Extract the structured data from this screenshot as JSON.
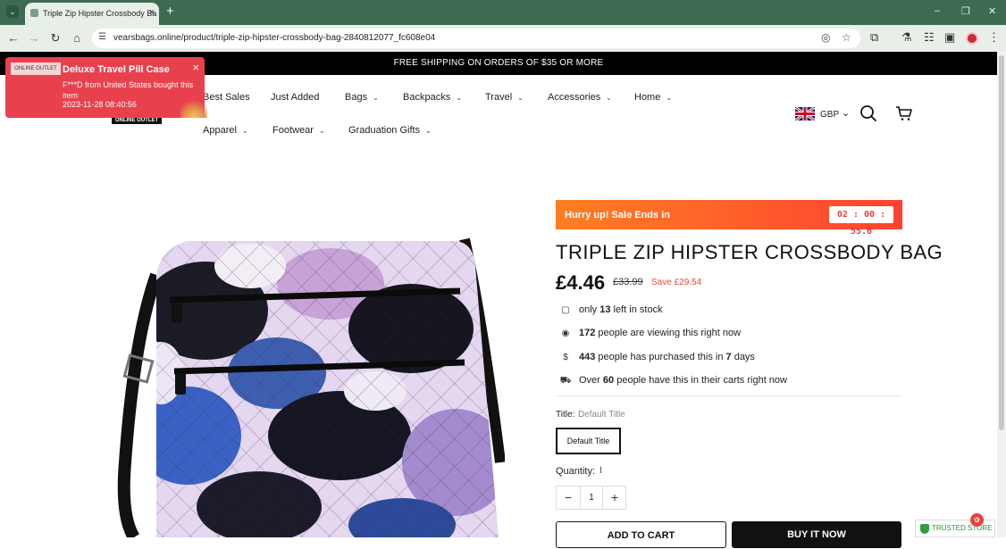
{
  "browser": {
    "tab_title": "Triple Zip Hipster Crossbody Ba",
    "tab_close": "×",
    "new_tab": "+",
    "url": "vearsbags.online/product/triple-zip-hipster-crossbody-bag-2840812077_fc608e04",
    "window_controls": [
      "–",
      "❐",
      "✕"
    ],
    "icons": [
      "back-arrow-icon",
      "forward-arrow-icon",
      "reload-icon",
      "home-icon",
      "site-settings-icon",
      "eye-off-icon",
      "star-icon",
      "extensions-icon",
      "flask-icon",
      "reading-list-icon",
      "side-panel-icon",
      "profile-avatar",
      "menu-dots-icon"
    ]
  },
  "announcement": "FREE SHIPPING ON ORDERS OF $35 OR MORE",
  "popup": {
    "image_caption": "ONLINE OUTLET",
    "title": "Deluxe Travel Pill Case",
    "body": "F***D from United States bought this item",
    "time": "2023-11-28 08:40:56",
    "close": "×"
  },
  "logo_text": "ONLINE OUTLET",
  "nav": {
    "row1": [
      "Best Sales",
      "Just Added",
      "Bags",
      "Backpacks",
      "Travel",
      "Accessories",
      "Home"
    ],
    "row2": [
      "Apparel",
      "Footwear",
      "Graduation Gifts"
    ],
    "dropdown_chevron": "⌄"
  },
  "currency": {
    "code": "GBP",
    "chevron": "⌄"
  },
  "urgency": {
    "label": "Hurry up! Sale Ends in",
    "timer": "02 : 00 : 55.6"
  },
  "product": {
    "title": "TRIPLE ZIP HIPSTER CROSSBODY BAG",
    "price": "£4.46",
    "compare_price": "£33.99",
    "save": "Save  £29.54",
    "stock_pre": "only ",
    "stock_num": "13",
    "stock_post": " left in stock",
    "viewing_num": "172",
    "viewing_post": " people are viewing this right now",
    "purchased_num": "443",
    "purchased_mid": " people has purchased this in ",
    "purchased_days": "7",
    "purchased_post": " days",
    "carts_pre": "Over ",
    "carts_num": "60",
    "carts_post": " people have this in their carts right now",
    "option_label": "Title:",
    "option_value": "Default Title",
    "variant": "Default Title",
    "quantity_label": "Quantity:",
    "quantity_cursor": "I",
    "quantity": "1",
    "minus": "−",
    "plus": "+",
    "add_to_cart": "ADD TO CART",
    "buy_now": "BUY IT NOW"
  },
  "trusted_badge": "TRUSTED STORE",
  "colors": {
    "accent_red": "#e8413d",
    "urgency_orange": "#ff7f22",
    "chrome_green": "#3d6b52"
  }
}
